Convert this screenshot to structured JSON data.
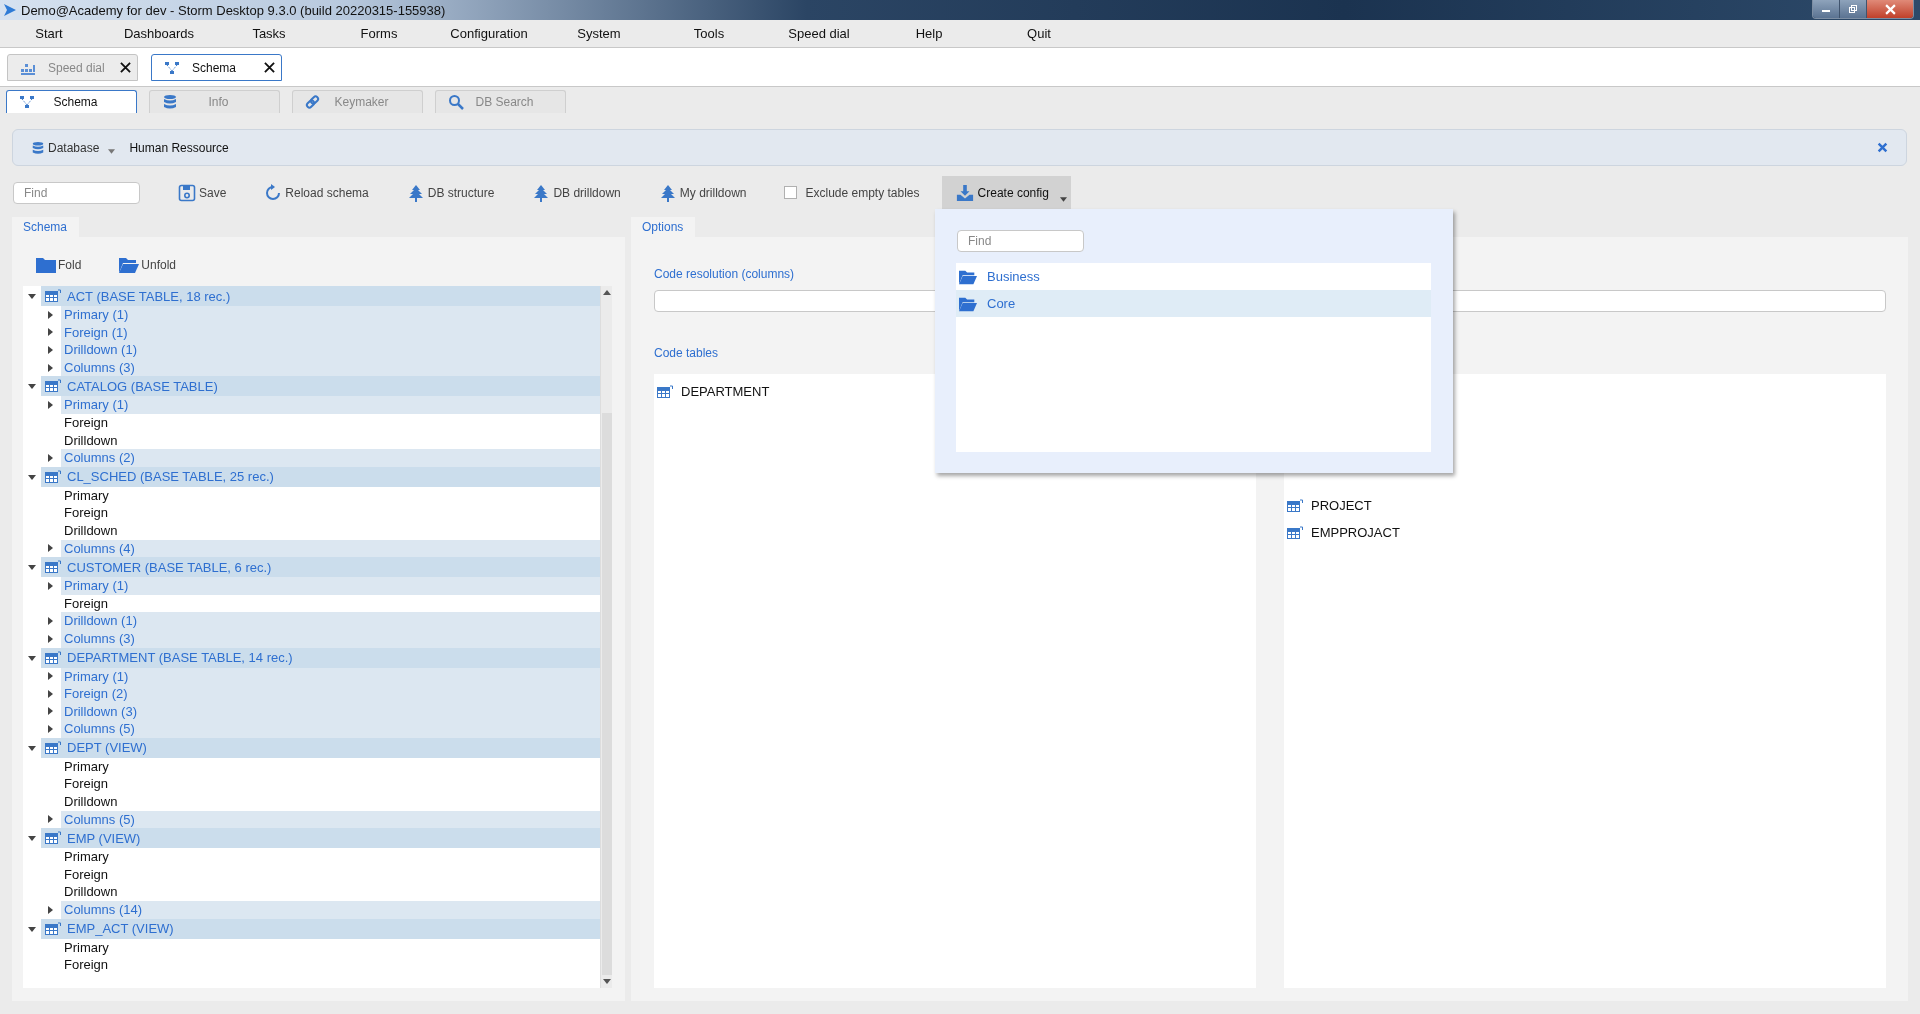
{
  "window": {
    "title": "Demo@Academy for dev -  Storm Desktop 9.3.0 (build 20220315-155938)"
  },
  "menu": [
    "Start",
    "Dashboards",
    "Tasks",
    "Forms",
    "Configuration",
    "System",
    "Tools",
    "Speed dial",
    "Help",
    "Quit"
  ],
  "doc_tabs": [
    {
      "label": "Speed dial",
      "selected": false
    },
    {
      "label": "Schema",
      "selected": true
    }
  ],
  "sub_tabs": [
    {
      "label": "Schema",
      "selected": true
    },
    {
      "label": "Info",
      "selected": false
    },
    {
      "label": "Keymaker",
      "selected": false
    },
    {
      "label": "DB Search",
      "selected": false
    }
  ],
  "breadcrumb": {
    "label": "Database",
    "value": "Human Ressource"
  },
  "toolbar": {
    "find_placeholder": "Find",
    "buttons": [
      "Save",
      "Reload schema",
      "DB structure",
      "DB drilldown",
      "My drilldown"
    ],
    "exclude_empty": {
      "label": "Exclude empty tables",
      "checked": false
    },
    "create_config": {
      "label": "Create config",
      "open": true
    }
  },
  "schema_panel": {
    "tab": "Schema",
    "fold": "Fold",
    "unfold": "Unfold",
    "tree": [
      {
        "label": "ACT (BASE TABLE, 18 rec.)",
        "expanded": true,
        "children": [
          {
            "label": "Primary (1)",
            "expandable": true
          },
          {
            "label": "Foreign (1)",
            "expandable": true
          },
          {
            "label": "Drilldown (1)",
            "expandable": true
          },
          {
            "label": "Columns (3)",
            "expandable": true
          }
        ]
      },
      {
        "label": "CATALOG (BASE TABLE)",
        "expanded": true,
        "children": [
          {
            "label": "Primary (1)",
            "expandable": true
          },
          {
            "label": "Foreign",
            "expandable": false
          },
          {
            "label": "Drilldown",
            "expandable": false
          },
          {
            "label": "Columns (2)",
            "expandable": true
          }
        ]
      },
      {
        "label": "CL_SCHED (BASE TABLE, 25 rec.)",
        "expanded": true,
        "children": [
          {
            "label": "Primary",
            "expandable": false
          },
          {
            "label": "Foreign",
            "expandable": false
          },
          {
            "label": "Drilldown",
            "expandable": false
          },
          {
            "label": "Columns (4)",
            "expandable": true
          }
        ]
      },
      {
        "label": "CUSTOMER (BASE TABLE, 6 rec.)",
        "expanded": true,
        "children": [
          {
            "label": "Primary (1)",
            "expandable": true
          },
          {
            "label": "Foreign",
            "expandable": false
          },
          {
            "label": "Drilldown (1)",
            "expandable": true
          },
          {
            "label": "Columns (3)",
            "expandable": true
          }
        ]
      },
      {
        "label": "DEPARTMENT (BASE TABLE, 14 rec.)",
        "expanded": true,
        "children": [
          {
            "label": "Primary (1)",
            "expandable": true
          },
          {
            "label": "Foreign (2)",
            "expandable": true
          },
          {
            "label": "Drilldown (3)",
            "expandable": true
          },
          {
            "label": "Columns (5)",
            "expandable": true
          }
        ]
      },
      {
        "label": "DEPT (VIEW)",
        "expanded": true,
        "children": [
          {
            "label": "Primary",
            "expandable": false
          },
          {
            "label": "Foreign",
            "expandable": false
          },
          {
            "label": "Drilldown",
            "expandable": false
          },
          {
            "label": "Columns (5)",
            "expandable": true
          }
        ]
      },
      {
        "label": "EMP (VIEW)",
        "expanded": true,
        "children": [
          {
            "label": "Primary",
            "expandable": false
          },
          {
            "label": "Foreign",
            "expandable": false
          },
          {
            "label": "Drilldown",
            "expandable": false
          },
          {
            "label": "Columns (14)",
            "expandable": true
          }
        ]
      },
      {
        "label": "EMP_ACT (VIEW)",
        "expanded": true,
        "children": [
          {
            "label": "Primary",
            "expandable": false
          },
          {
            "label": "Foreign",
            "expandable": false
          }
        ]
      }
    ]
  },
  "options_panel": {
    "tab": "Options",
    "code_resolution_label": "Code resolution (columns)",
    "code_tables_label": "Code tables",
    "code_tables": [
      "DEPARTMENT"
    ],
    "other_tables": [
      "PROJECT",
      "EMPPROJACT"
    ]
  },
  "config_menu": {
    "placeholder": "Find",
    "items": [
      {
        "label": "Business",
        "selected": false
      },
      {
        "label": "Core",
        "selected": true
      }
    ]
  }
}
